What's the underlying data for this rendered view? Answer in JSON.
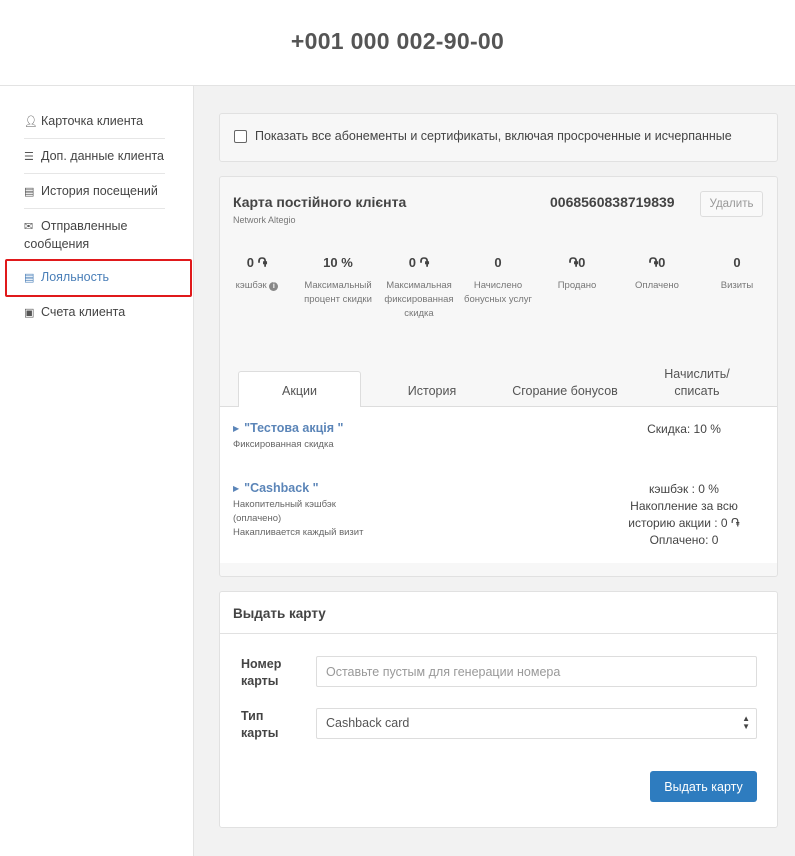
{
  "header": {
    "phone": "+001 000 002-90-00"
  },
  "sidebar": {
    "items": [
      {
        "icon": "user-icon",
        "label": "Карточка клиента"
      },
      {
        "icon": "list-icon",
        "label": "Доп. данные клиента"
      },
      {
        "icon": "history-icon",
        "label": "История посещений"
      },
      {
        "icon": "envelope-icon",
        "label": "Отправленные сообщения"
      },
      {
        "icon": "card-icon",
        "label": "Лояльность",
        "active": true
      },
      {
        "icon": "briefcase-icon",
        "label": "Счета клиента"
      }
    ]
  },
  "filters": {
    "show_all_label": "Показать все абонементы и сертификаты, включая просроченные и исчерпанные"
  },
  "card": {
    "title": "Карта постійного клієнта",
    "network": "Network Altegio",
    "number": "0068560838719839",
    "delete_label": "Удалить",
    "stats": [
      {
        "value": "0 ֏",
        "label": "кэшбэк"
      },
      {
        "value": "10 %",
        "label": "Максимальный процент скидки"
      },
      {
        "value": "0 ֏",
        "label": "Максимальная фиксированная скидка"
      },
      {
        "value": "0",
        "label": "Начислено бонусных услуг"
      },
      {
        "value": "֏0",
        "label": "Продано"
      },
      {
        "value": "֏0",
        "label": "Оплачено"
      },
      {
        "value": "0",
        "label": "Визиты"
      }
    ],
    "tabs": [
      "Акции",
      "История",
      "Сгорание бонусов",
      "Начислить/ списать"
    ],
    "promos": [
      {
        "name": "\"Тестова акція \"",
        "desc": [
          "Фиксированная скидка"
        ],
        "right": [
          "Скидка: 10 %"
        ]
      },
      {
        "name": "\"Cashback \"",
        "desc": [
          "Накопительный кэшбэк",
          "(оплачено)",
          "Накапливается каждый визит"
        ],
        "right": [
          "кэшбэк : 0 %",
          "Накопление за всю",
          "историю акции : 0 ֏",
          "Оплачено: 0"
        ]
      }
    ]
  },
  "issue": {
    "title": "Выдать карту",
    "number_label": "Номер карты",
    "number_placeholder": "Оставьте пустым для генерации номера",
    "type_label": "Тип карты",
    "type_value": "Cashback card",
    "submit_label": "Выдать карту"
  },
  "colors": {
    "accent": "#2e7cbf",
    "link": "#5b85b8",
    "highlight": "#e0191b"
  }
}
